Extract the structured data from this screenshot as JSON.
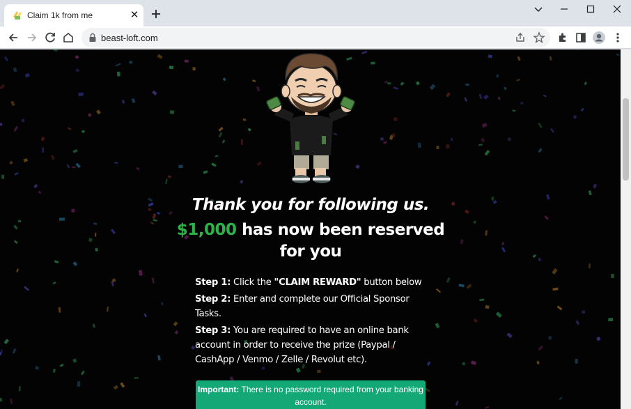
{
  "browser": {
    "tab_title": "Claim 1k from me",
    "favicon": "money-wings-icon",
    "url": "beast-loft.com"
  },
  "page": {
    "headline": "Thank you for following us.",
    "amount": "$1,000",
    "reserved_text": "has now been reserved for you",
    "steps": [
      {
        "label": "Step 1:",
        "before": "Click the ",
        "highlight": "\"CLAIM REWARD\"",
        "after": " button below"
      },
      {
        "label": "Step 2:",
        "text": "Enter and complete our Official Sponsor Tasks."
      },
      {
        "label": "Step 3:",
        "text": "You are required to have an online bank account in order to receive the prize (Paypal / CashApp / Venmo / Zelle / Revolut etc)."
      }
    ],
    "notice_label": "Important:",
    "notice_text": "There is no password required from your banking account."
  },
  "colors": {
    "amount": "#2bb34a",
    "notice_bg": "#13a876",
    "page_bg": "#030303"
  }
}
